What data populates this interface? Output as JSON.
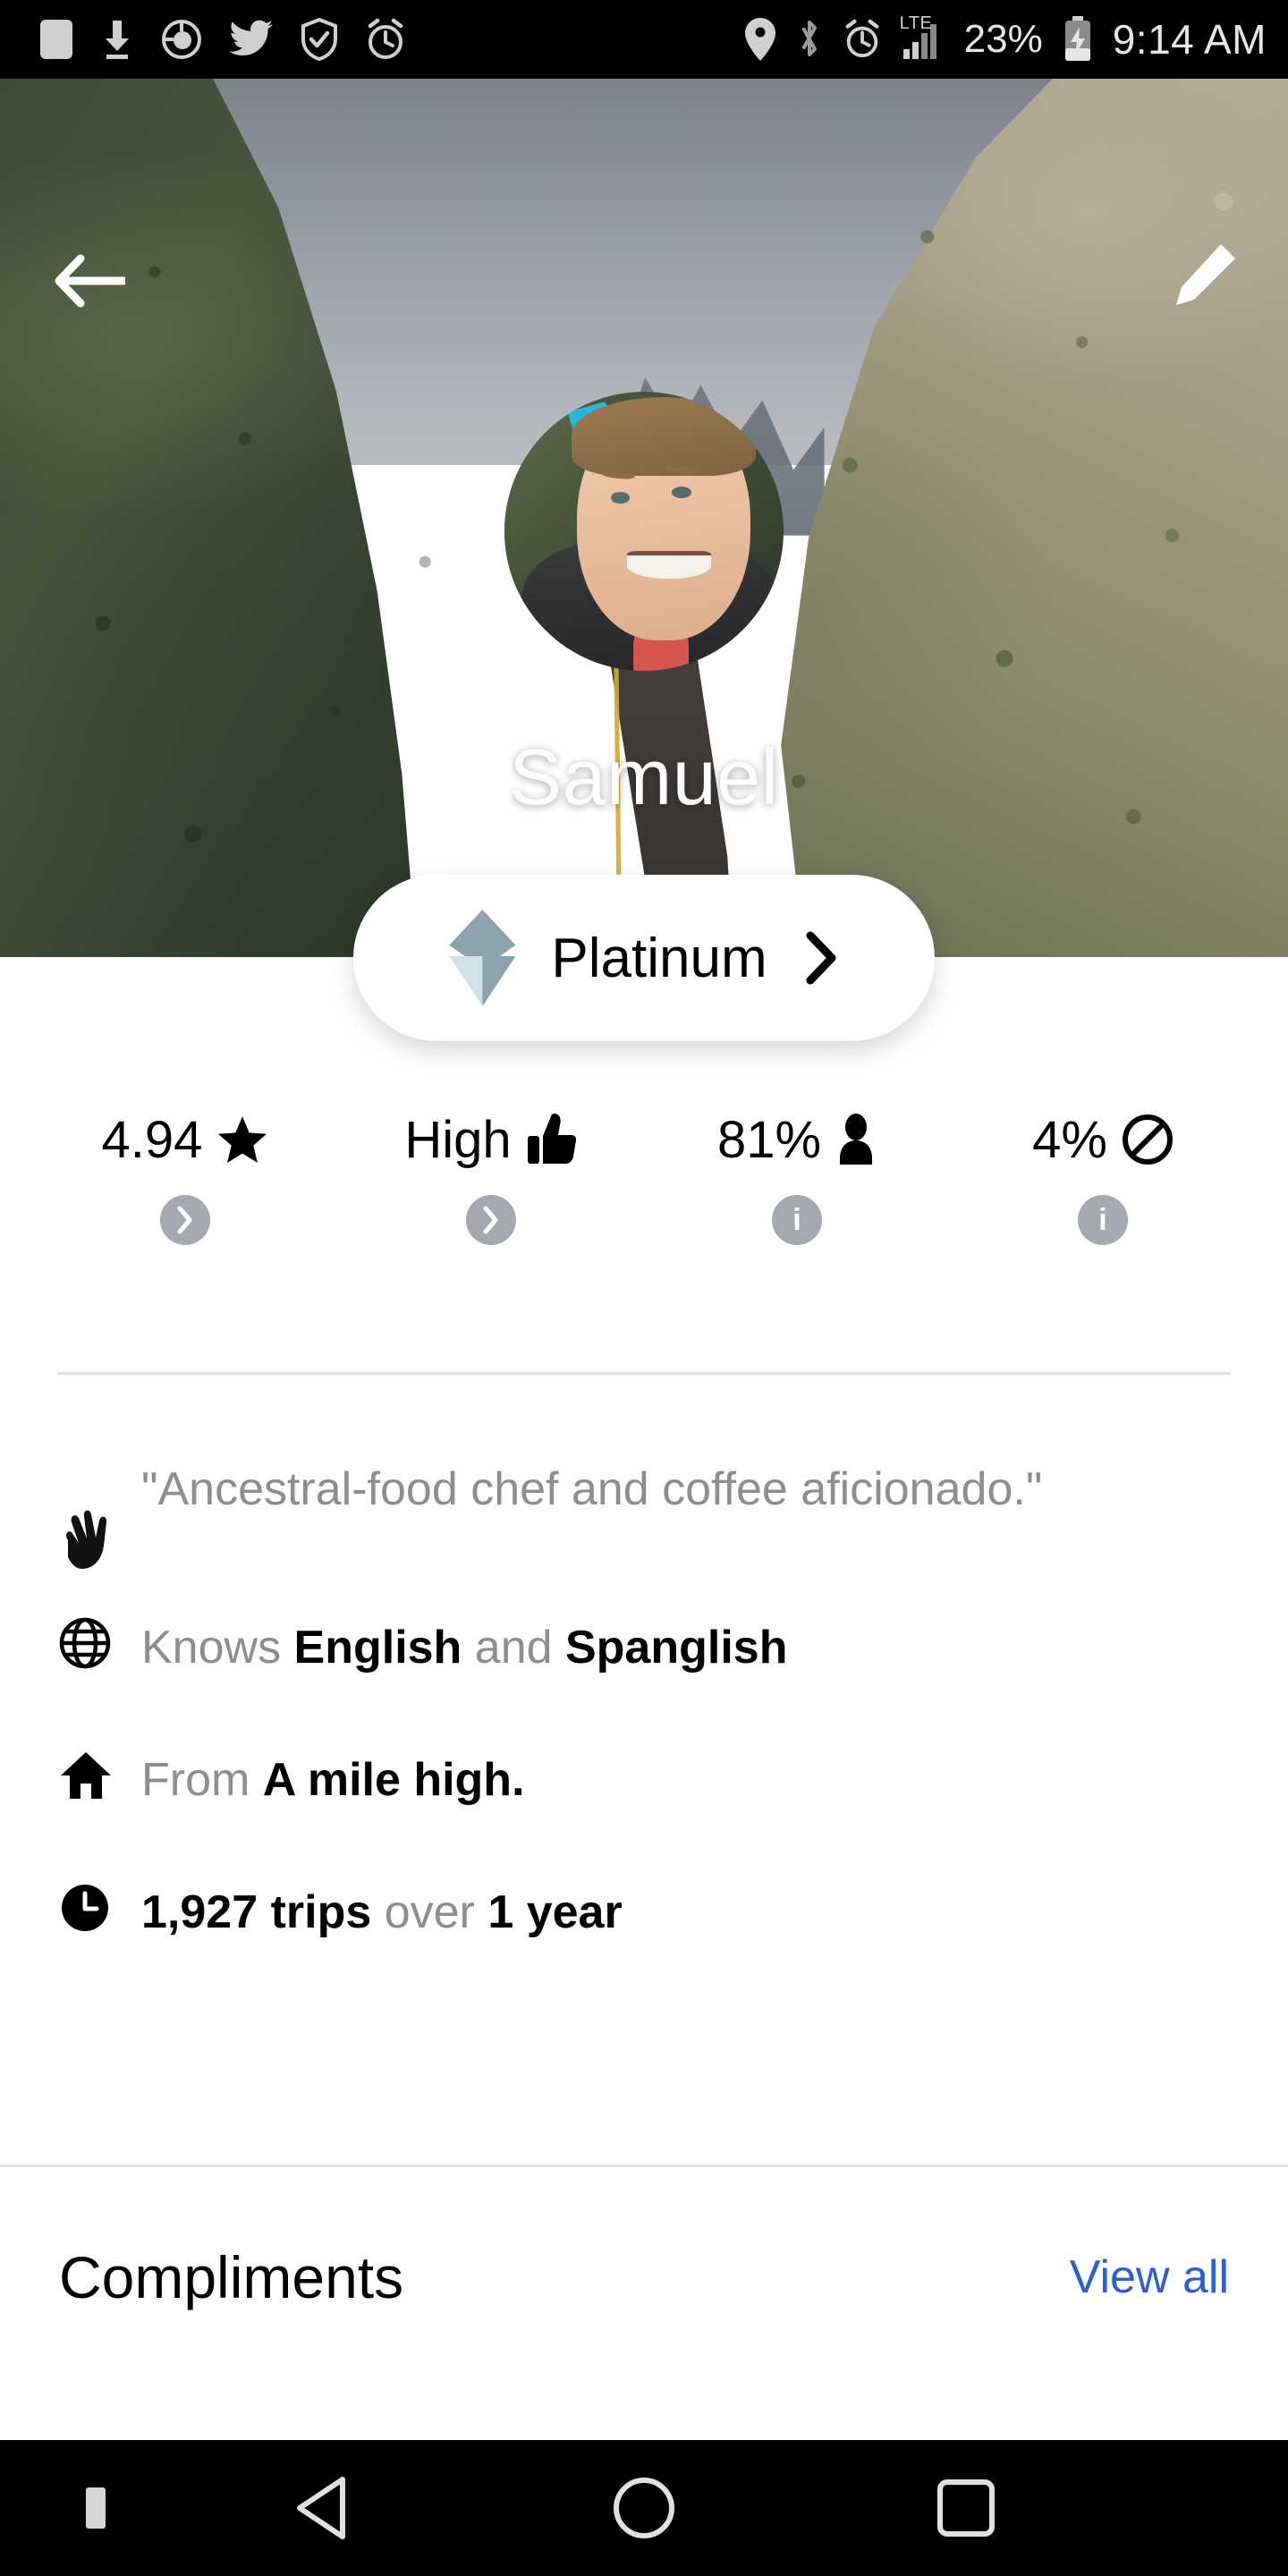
{
  "status_bar": {
    "left_icons": [
      {
        "name": "app-notification-icon",
        "glyph": "square"
      },
      {
        "name": "download-icon",
        "glyph": "download-arrow"
      },
      {
        "name": "sync-circle-icon",
        "glyph": "pie-circle"
      },
      {
        "name": "twitter-icon",
        "glyph": "bird"
      },
      {
        "name": "shield-check-icon",
        "glyph": "shield"
      },
      {
        "name": "alarm-clock-icon",
        "glyph": "alarm"
      }
    ],
    "right_icons": [
      {
        "name": "location-pin-icon",
        "glyph": "pin"
      },
      {
        "name": "bluetooth-icon",
        "glyph": "bluetooth"
      },
      {
        "name": "alarm-clock-icon",
        "glyph": "alarm"
      }
    ],
    "network_label": "LTE",
    "battery_percent": "23%",
    "time": "9:14 AM"
  },
  "header": {
    "back_label": "Back",
    "edit_label": "Edit profile",
    "name": "Samuel"
  },
  "tier": {
    "label": "Platinum",
    "chevron": "›",
    "diamond_top_color": "#8ca3ae",
    "diamond_bottom_color": "#cfe2e6"
  },
  "stats": [
    {
      "value": "4.94",
      "icon": "star-icon",
      "action_icon": "chevron-right-icon",
      "name": "rating"
    },
    {
      "value": "High",
      "icon": "thumbs-up-icon",
      "action_icon": "chevron-right-icon",
      "name": "compliment-level"
    },
    {
      "value": "81%",
      "icon": "person-icon",
      "action_icon": "info-icon",
      "name": "acceptance-rate"
    },
    {
      "value": "4%",
      "icon": "no-entry-icon",
      "action_icon": "info-icon",
      "name": "cancellation-rate"
    }
  ],
  "info": {
    "bio": {
      "icon": "waving-hand-icon",
      "text": "\"Ancestral-food chef and coffee aficionado.\""
    },
    "languages": {
      "icon": "globe-icon",
      "prefix": "Knows ",
      "value_1": "English",
      "middle": " and ",
      "value_2": "Spanglish"
    },
    "hometown": {
      "icon": "home-icon",
      "prefix": "From ",
      "value": "A mile high."
    },
    "trips": {
      "icon": "clock-icon",
      "value_1": "1,927 trips",
      "middle": " over ",
      "value_2": "1 year"
    }
  },
  "compliments": {
    "title": "Compliments",
    "view_all": "View all",
    "link_color": "#2f5ed2"
  },
  "navbar": {
    "back_label": "Back",
    "home_label": "Home",
    "recents_label": "Recent apps"
  }
}
